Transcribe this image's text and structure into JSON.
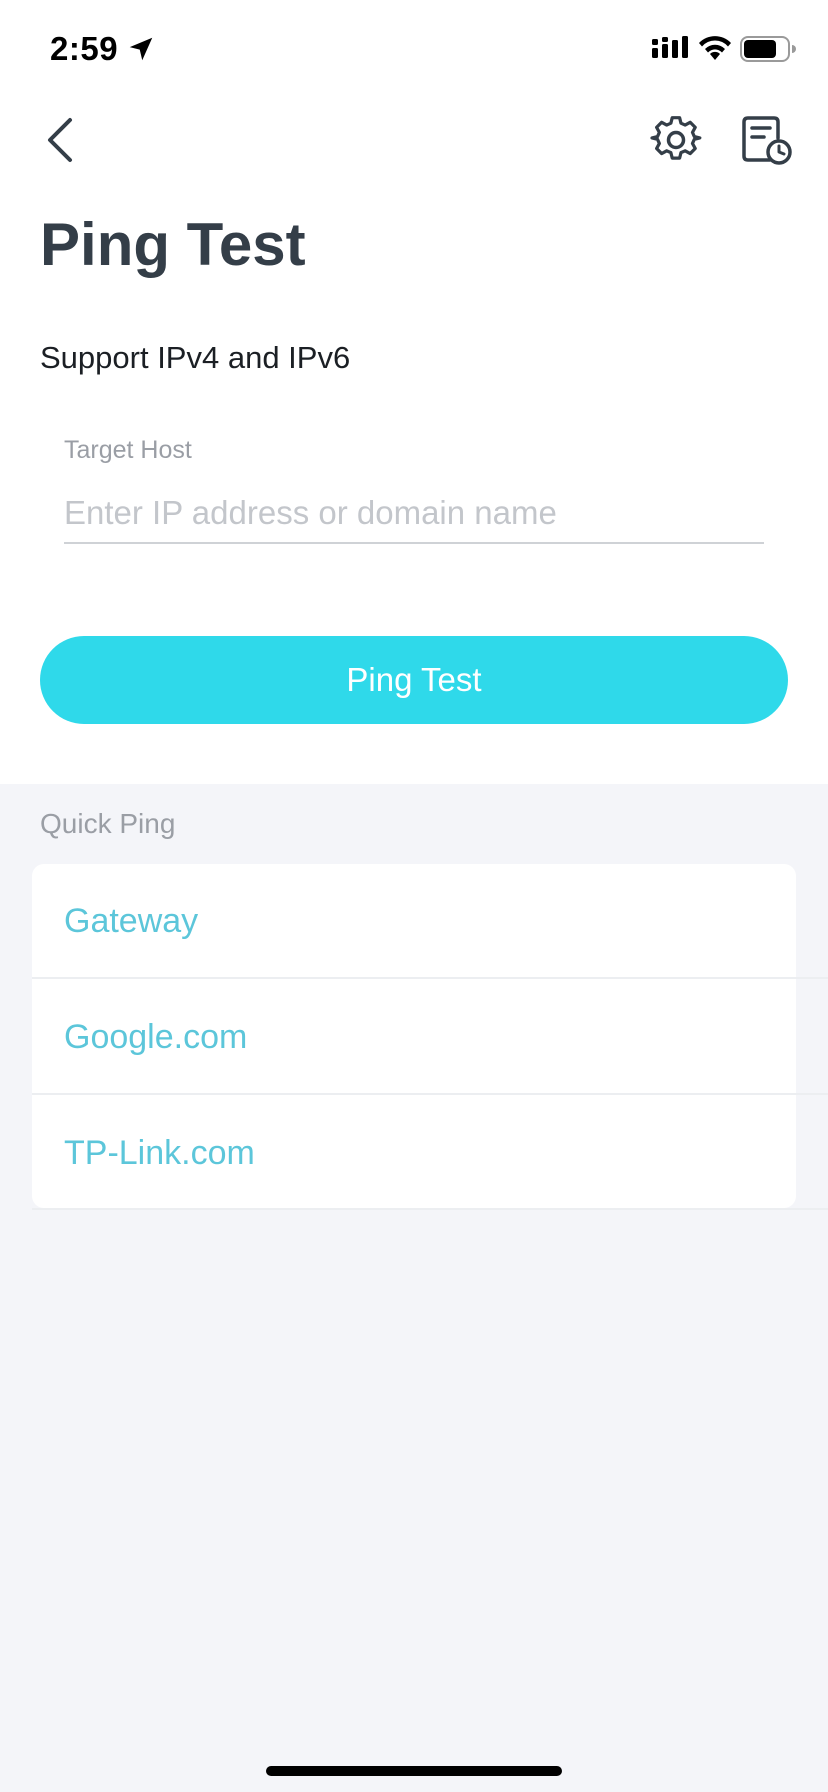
{
  "status_bar": {
    "time": "2:59",
    "icons": [
      "location-arrow-icon",
      "cellular-signal-icon",
      "wifi-icon",
      "battery-icon"
    ]
  },
  "nav": {
    "back_icon": "chevron-left-icon",
    "settings_icon": "gear-icon",
    "history_icon": "document-clock-icon"
  },
  "page": {
    "title": "Ping Test",
    "subtitle": "Support IPv4 and IPv6"
  },
  "form": {
    "field_label": "Target Host",
    "input_value": "",
    "input_placeholder": "Enter IP address or domain name",
    "submit_label": "Ping Test"
  },
  "quick_ping": {
    "label": "Quick Ping",
    "items": [
      {
        "label": "Gateway"
      },
      {
        "label": "Google.com"
      },
      {
        "label": "TP-Link.com"
      }
    ]
  },
  "colors": {
    "accent": "#2fd9ea",
    "link": "#5cc6da",
    "title": "#343e48",
    "background": "#f4f5f9"
  }
}
